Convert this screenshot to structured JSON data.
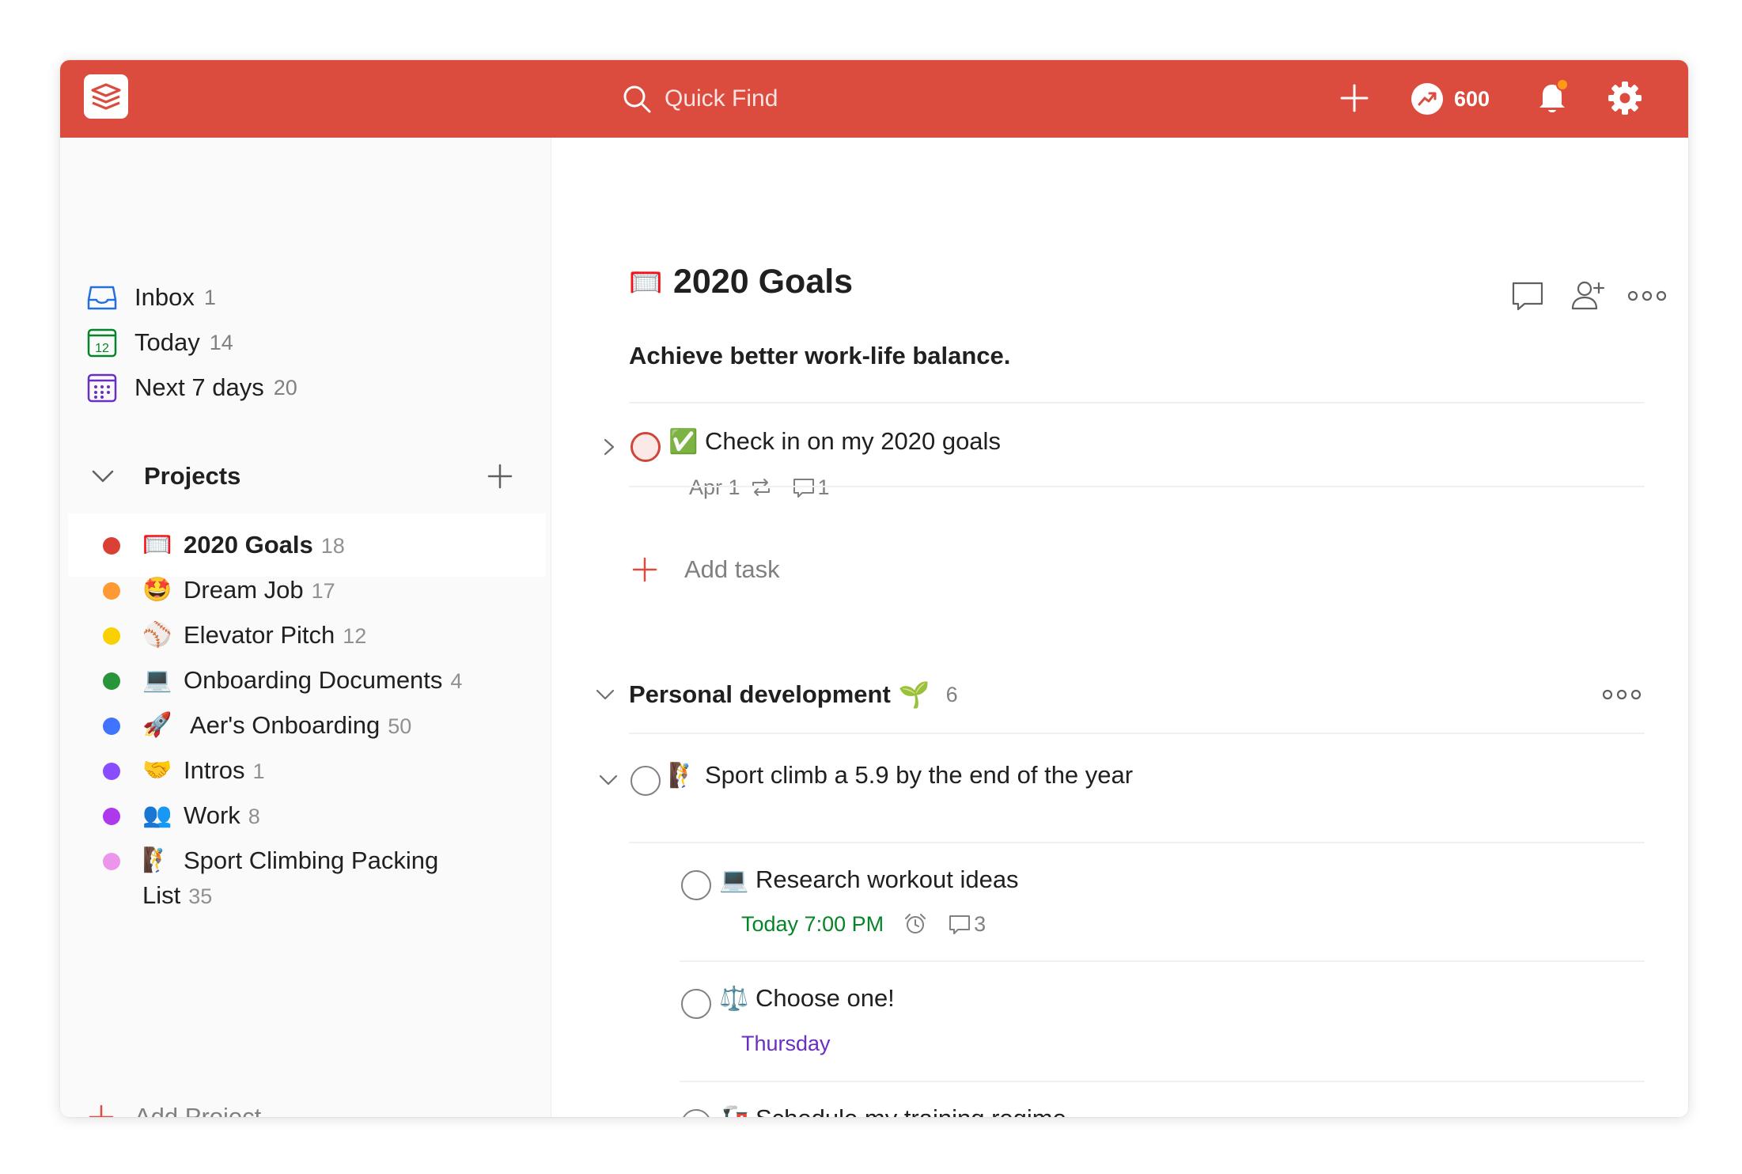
{
  "topbar": {
    "search_placeholder": "Quick Find",
    "karma_count": "600",
    "accent_color": "#db4c3f"
  },
  "sidebar": {
    "nav": [
      {
        "label": "Inbox",
        "count": "1",
        "icon": "inbox-icon"
      },
      {
        "label": "Today",
        "count": "14",
        "icon": "calendar-today-icon",
        "day": "12"
      },
      {
        "label": "Next 7 days",
        "count": "20",
        "icon": "calendar-week-icon"
      }
    ],
    "projects_label": "Projects",
    "projects": [
      {
        "name": "2020 Goals",
        "count": "18",
        "color": "#db4035",
        "emoji": "🥅",
        "selected": true
      },
      {
        "name": "Dream Job",
        "count": "17",
        "color": "#ff9933",
        "emoji": "🤩"
      },
      {
        "name": "Elevator Pitch",
        "count": "12",
        "color": "#fad000",
        "emoji": "⚾"
      },
      {
        "name": "Onboarding Documents",
        "count": "4",
        "color": "#299438",
        "emoji": "💻"
      },
      {
        "name": "Aer's Onboarding",
        "count": "50",
        "color": "#4073ff",
        "emoji": "🚀"
      },
      {
        "name": "Intros",
        "count": "1",
        "color": "#884dff",
        "emoji": "🤝"
      },
      {
        "name": "Work",
        "count": "8",
        "color": "#af38eb",
        "emoji": "👥"
      },
      {
        "name_line1": "Sport Climbing Packing",
        "name_line2": "List",
        "count": "35",
        "color": "#eb96eb",
        "emoji": "🧗"
      }
    ],
    "add_project_label": "Add Project"
  },
  "main": {
    "title_emoji": "🥅",
    "title": "2020 Goals",
    "description": "Achieve better work-life balance.",
    "task1": {
      "emoji": "✅",
      "title": "Check in on my 2020 goals",
      "date": "Apr 1",
      "comments": "1"
    },
    "add_task_label": "Add task",
    "section": {
      "title": "Personal development",
      "emoji": "🌱",
      "count": "6"
    },
    "task2": {
      "emoji": "🧗",
      "title": "Sport climb a 5.9 by the end of the year"
    },
    "subtasks": [
      {
        "emoji": "💻",
        "title": "Research workout ideas",
        "due": "Today 7:00 PM",
        "comments": "3"
      },
      {
        "emoji": "⚖️",
        "title": "Choose one!",
        "due": "Thursday"
      },
      {
        "emoji": "🚂",
        "title": "Schedule my training regime"
      }
    ]
  }
}
